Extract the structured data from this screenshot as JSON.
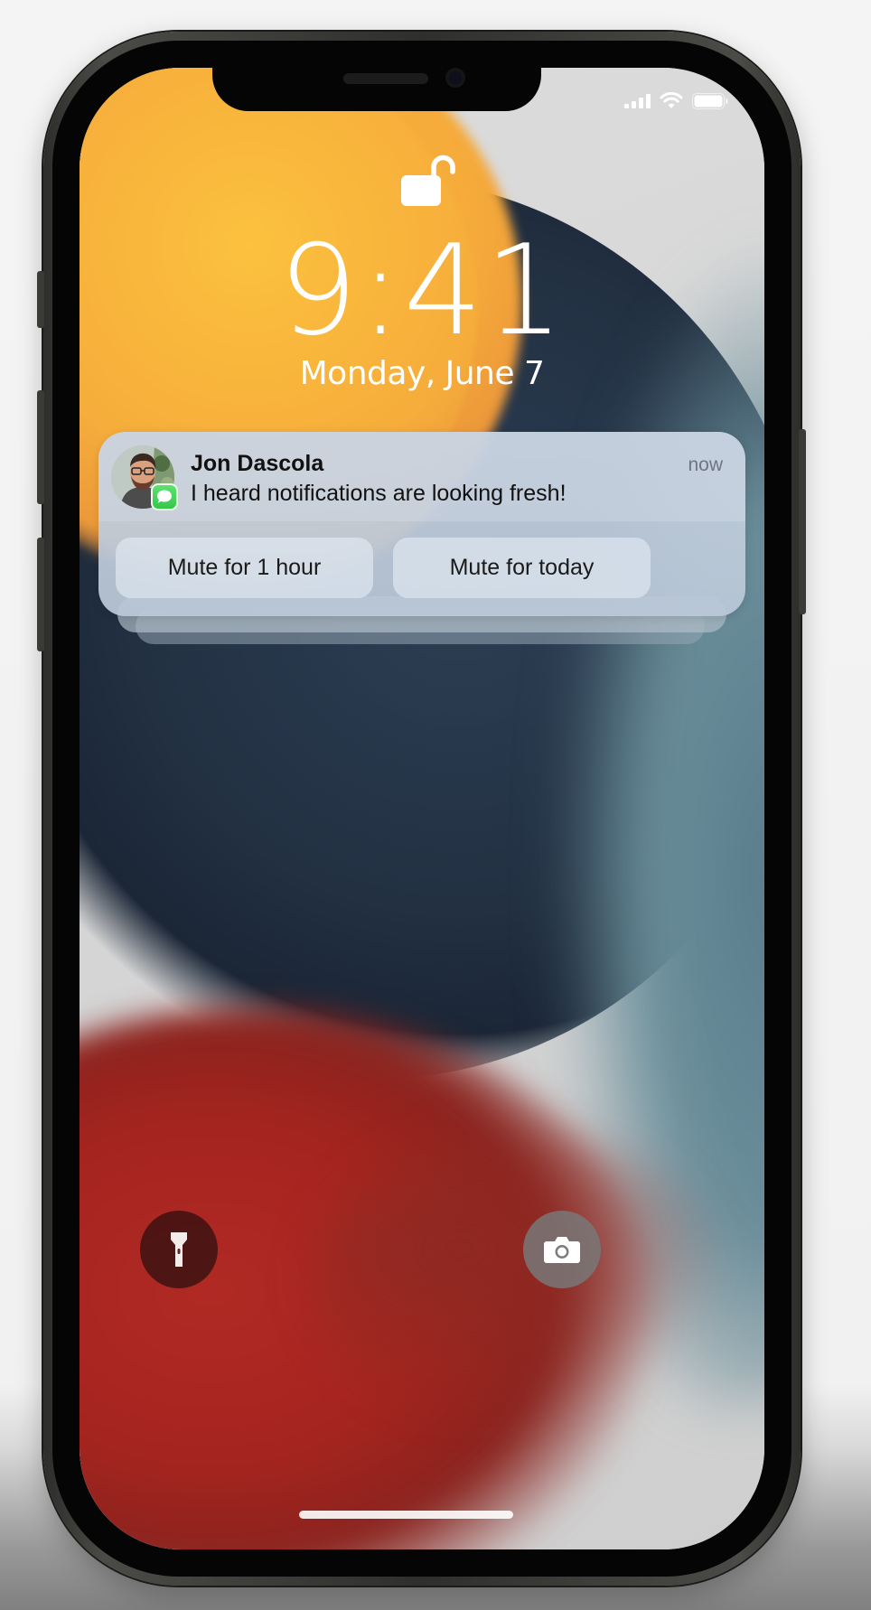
{
  "status_bar": {
    "signal_icon": "cellular-signal-icon",
    "wifi_icon": "wifi-icon",
    "battery_icon": "battery-icon"
  },
  "lock_screen": {
    "lock_icon": "unlocked-padlock-icon",
    "time": "9:41",
    "date": "Monday, June 7"
  },
  "notification": {
    "sender": "Jon Dascola",
    "timestamp": "now",
    "message": "I heard notifications are looking fresh!",
    "app_icon": "messages-app-icon",
    "actions": [
      {
        "label": "Mute for 1 hour"
      },
      {
        "label": "Mute for today"
      }
    ],
    "colors": {
      "badge": "#34c74a"
    }
  },
  "quick_actions": {
    "flashlight_icon": "flashlight-icon",
    "camera_icon": "camera-icon"
  },
  "wallpaper_colors": [
    "#f6ad3b",
    "#223042",
    "#6a8e9a",
    "#a5241f",
    "#d6d6d6"
  ]
}
